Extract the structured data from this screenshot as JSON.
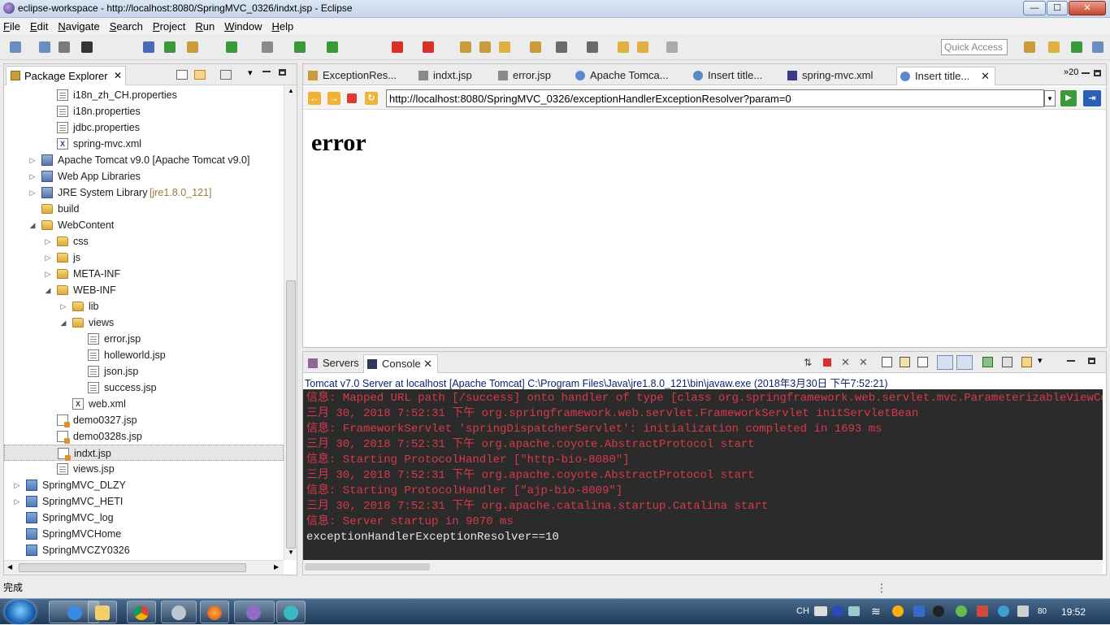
{
  "window": {
    "title": "eclipse-workspace - http://localhost:8080/SpringMVC_0326/indxt.jsp - Eclipse",
    "min": "—",
    "max": "☐",
    "close": "✕"
  },
  "menu": [
    "File",
    "Edit",
    "Navigate",
    "Search",
    "Project",
    "Run",
    "Window",
    "Help"
  ],
  "toolbar": {
    "quick_access": "Quick Access"
  },
  "package_explorer": {
    "title": "Package Explorer",
    "close": "✕",
    "rows": [
      {
        "label": "i18n_zh_CH.properties",
        "indent": 3,
        "icon": "file",
        "twisty": ""
      },
      {
        "label": "i18n.properties",
        "indent": 3,
        "icon": "file",
        "twisty": ""
      },
      {
        "label": "jdbc.properties",
        "indent": 3,
        "icon": "file",
        "twisty": ""
      },
      {
        "label": "spring-mvc.xml",
        "indent": 3,
        "icon": "xml",
        "twisty": ""
      },
      {
        "label": "Apache Tomcat v9.0 [Apache Tomcat v9.0]",
        "indent": 2,
        "icon": "lib",
        "twisty": "▷"
      },
      {
        "label": "Web App Libraries",
        "indent": 2,
        "icon": "lib",
        "twisty": "▷"
      },
      {
        "label": "JRE System Library ",
        "suffix": "[jre1.8.0_121]",
        "indent": 2,
        "icon": "lib",
        "twisty": "▷"
      },
      {
        "label": "build",
        "indent": 2,
        "icon": "folder",
        "twisty": ""
      },
      {
        "label": "WebContent",
        "indent": 2,
        "icon": "folder",
        "twisty": "◢"
      },
      {
        "label": "css",
        "indent": 3,
        "icon": "folder",
        "twisty": "▷"
      },
      {
        "label": "js",
        "indent": 3,
        "icon": "folder",
        "twisty": "▷"
      },
      {
        "label": "META-INF",
        "indent": 3,
        "icon": "folder",
        "twisty": "▷"
      },
      {
        "label": "WEB-INF",
        "indent": 3,
        "icon": "folder",
        "twisty": "◢"
      },
      {
        "label": "lib",
        "indent": 4,
        "icon": "folder",
        "twisty": "▷"
      },
      {
        "label": "views",
        "indent": 4,
        "icon": "folder",
        "twisty": "◢"
      },
      {
        "label": "error.jsp",
        "indent": 5,
        "icon": "file",
        "twisty": ""
      },
      {
        "label": "holleworld.jsp",
        "indent": 5,
        "icon": "file",
        "twisty": ""
      },
      {
        "label": "json.jsp",
        "indent": 5,
        "icon": "file",
        "twisty": ""
      },
      {
        "label": "success.jsp",
        "indent": 5,
        "icon": "file",
        "twisty": ""
      },
      {
        "label": "web.xml",
        "indent": 4,
        "icon": "xml",
        "twisty": ""
      },
      {
        "label": "demo0327.jsp",
        "indent": 3,
        "icon": "jsp",
        "twisty": ""
      },
      {
        "label": "demo0328s.jsp",
        "indent": 3,
        "icon": "jsp",
        "twisty": ""
      },
      {
        "label": "indxt.jsp",
        "indent": 3,
        "icon": "jsp",
        "twisty": "",
        "selected": true
      },
      {
        "label": "views.jsp",
        "indent": 3,
        "icon": "file",
        "twisty": ""
      },
      {
        "label": "SpringMVC_DLZY",
        "indent": 1,
        "icon": "proj",
        "twisty": "▷"
      },
      {
        "label": "SpringMVC_HETI",
        "indent": 1,
        "icon": "proj",
        "twisty": "▷"
      },
      {
        "label": "SpringMVC_log",
        "indent": 1,
        "icon": "proj",
        "twisty": ""
      },
      {
        "label": "SpringMVCHome",
        "indent": 1,
        "icon": "proj",
        "twisty": ""
      },
      {
        "label": "SpringMVCZY0326",
        "indent": 1,
        "icon": "proj",
        "twisty": ""
      }
    ]
  },
  "editor": {
    "tabs": [
      {
        "label": "ExceptionRes...",
        "icon": "java"
      },
      {
        "label": "indxt.jsp",
        "icon": "file"
      },
      {
        "label": "error.jsp",
        "icon": "file"
      },
      {
        "label": "Apache Tomca...",
        "icon": "globe"
      },
      {
        "label": "Insert title...",
        "icon": "globe"
      },
      {
        "label": "spring-mvc.xml",
        "icon": "xml"
      },
      {
        "label": "Insert title...",
        "icon": "globe",
        "active": true
      }
    ],
    "overflow": "»20",
    "url": "http://localhost:8080/SpringMVC_0326/exceptionHandlerExceptionResolver?param=0",
    "page_heading": "error"
  },
  "console": {
    "tabs": [
      {
        "label": "Servers"
      },
      {
        "label": "Console",
        "active": true
      }
    ],
    "title": "Tomcat v7.0 Server at localhost [Apache Tomcat] C:\\Program Files\\Java\\jre1.8.0_121\\bin\\javaw.exe (2018年3月30日 下午7:52:21)",
    "lines": [
      {
        "text": "信息: Mapped URL path [/success] onto handler of type [class org.springframework.web.servlet.mvc.ParameterizableViewController]",
        "color": "red"
      },
      {
        "text": "三月 30, 2018 7:52:31 下午 org.springframework.web.servlet.FrameworkServlet initServletBean",
        "color": "red"
      },
      {
        "text": "信息: FrameworkServlet 'springDispatcherServlet': initialization completed in 1693 ms",
        "color": "red"
      },
      {
        "text": "三月 30, 2018 7:52:31 下午 org.apache.coyote.AbstractProtocol start",
        "color": "red"
      },
      {
        "text": "信息: Starting ProtocolHandler [\"http-bio-8080\"]",
        "color": "red"
      },
      {
        "text": "三月 30, 2018 7:52:31 下午 org.apache.coyote.AbstractProtocol start",
        "color": "red"
      },
      {
        "text": "信息: Starting ProtocolHandler [\"ajp-bio-8009\"]",
        "color": "red"
      },
      {
        "text": "三月 30, 2018 7:52:31 下午 org.apache.catalina.startup.Catalina start",
        "color": "red"
      },
      {
        "text": "信息: Server startup in 9070 ms",
        "color": "red"
      },
      {
        "text": "exceptionHandlerExceptionResolver==10",
        "color": "white"
      }
    ]
  },
  "status": {
    "text": "完成"
  },
  "taskbar": {
    "ime": "CH",
    "clock": "19:52",
    "volume": "80"
  }
}
